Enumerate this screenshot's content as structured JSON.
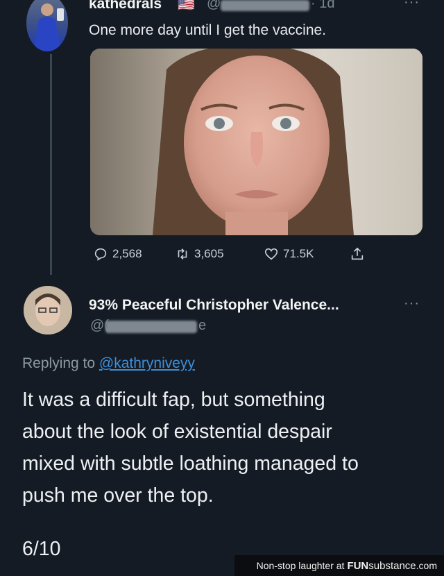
{
  "tweet1": {
    "display_name": "kathedrals",
    "flag": "🇺🇸",
    "handle_prefix": "@",
    "time": "· 1d",
    "text": "One more day until I get the vaccine.",
    "actions": {
      "replies": "2,568",
      "retweets": "3,605",
      "likes": "71.5K"
    }
  },
  "tweet2": {
    "display_name": "93% Peaceful Christopher Valence...",
    "handle_prefix": "@(",
    "handle_suffix": "e",
    "replying_to_label": "Replying to",
    "replying_to_handle": "@kathryniveyy",
    "text_lines": [
      "It was a difficult fap, but something",
      "about the look of existential despair",
      "mixed with subtle loathing managed to",
      "push me over the top."
    ],
    "rating": "6/10"
  },
  "footer": {
    "text": "Non-stop laughter at",
    "brand_bold": "FUN",
    "brand_rest": "substance",
    "tld": ".com"
  },
  "colors": {
    "background": "#151b24",
    "link": "#3d8fd8",
    "muted": "#7c8894"
  },
  "icons": [
    "reply-icon",
    "retweet-icon",
    "like-icon",
    "share-icon",
    "more-options-icon"
  ]
}
